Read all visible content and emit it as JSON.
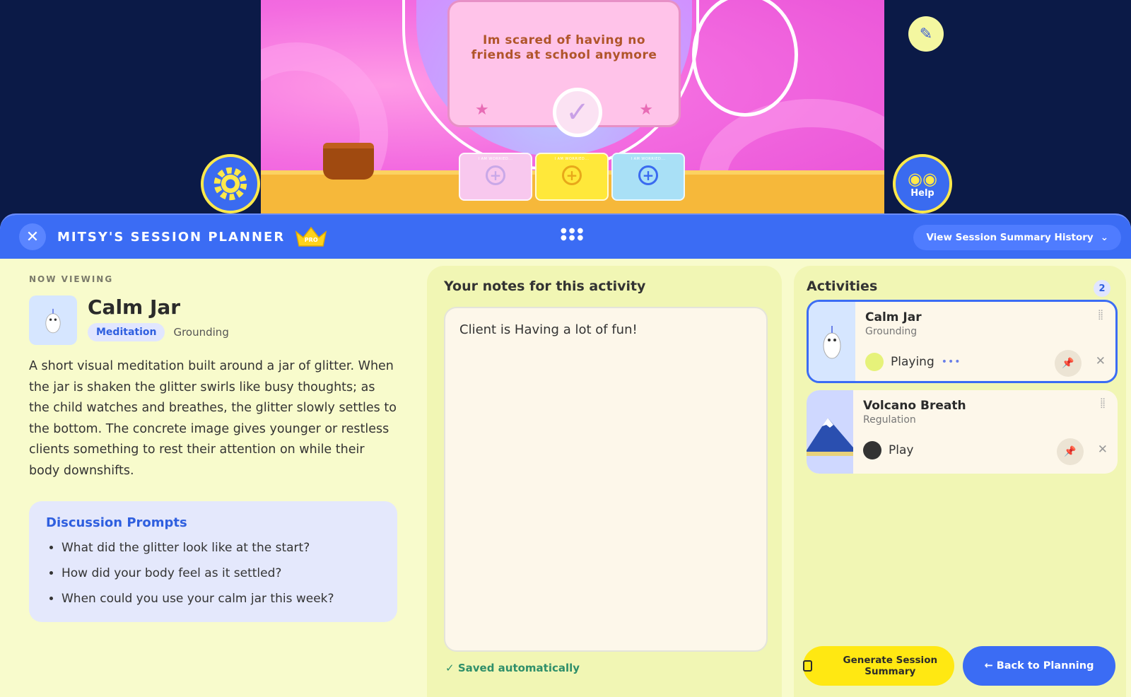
{
  "game": {
    "card_prompt": "Im scared of having no friends at school anymore",
    "slot_labels": [
      "I AM WORRIED...",
      "I AM WORRIED...",
      "I AM WORRIED..."
    ],
    "help_label": "Help"
  },
  "planner": {
    "title": "MITSY'S SESSION PLANNER",
    "badge": "PRO",
    "history_button": "View Session Summary History",
    "now_viewing_label": "NOW VIEWING",
    "activity": {
      "title": "Calm Jar",
      "tag_primary": "Meditation",
      "tag_secondary": "Grounding",
      "description": "A short visual meditation built around a jar of glitter. When the jar is shaken the glitter swirls like busy thoughts; as the child watches and breathes, the glitter slowly settles to the bottom. The concrete image gives younger or restless clients something to rest their attention on while their body downshifts."
    },
    "prompts": {
      "title": "Discussion Prompts",
      "items": [
        "What did the glitter look like at the start?",
        "How did your body feel as it settled?",
        "When could you use your calm jar this week?"
      ]
    },
    "notes": {
      "title": "Your notes for this activity",
      "value": "Client is Having a lot of fun!",
      "saved_label": "Saved automatically"
    },
    "activities": {
      "title": "Activities",
      "count": "2",
      "items": [
        {
          "title": "Calm Jar",
          "category": "Grounding",
          "status": "Playing",
          "status_color": "#e6f27a",
          "active": true
        },
        {
          "title": "Volcano Breath",
          "category": "Regulation",
          "status": "Play",
          "status_color": "#333333",
          "active": false
        }
      ]
    },
    "generate_button": "Generate Session Summary",
    "back_button": "← Back to Planning"
  },
  "colors": {
    "primary_blue": "#3b6cf4",
    "panel_yellow": "#f8fbcc",
    "accent_yellow": "#ffe812",
    "stage_pink": "#f36be0",
    "saved_green": "#2f8f6a"
  }
}
